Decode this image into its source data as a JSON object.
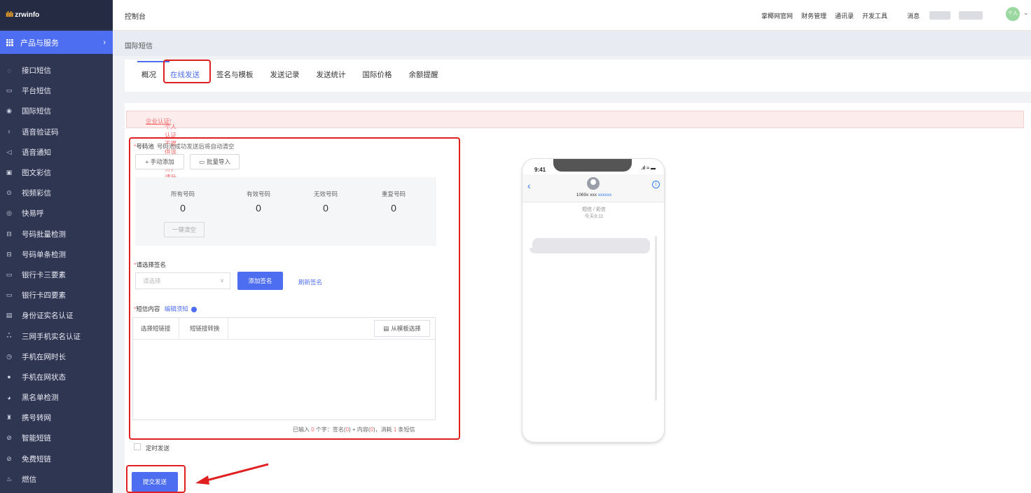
{
  "app": {
    "logo_mark": "ılılı",
    "logo_text": "zrwinfo",
    "section_title": "控制台"
  },
  "sidebar": {
    "product_label": "产品与服务",
    "items": [
      {
        "label": "接口短信",
        "icon": "chat-bubble-icon"
      },
      {
        "label": "平台短信",
        "icon": "message-icon"
      },
      {
        "label": "国际短信",
        "icon": "globe-icon"
      },
      {
        "label": "语音验证码",
        "icon": "microphone-icon"
      },
      {
        "label": "语音通知",
        "icon": "speaker-icon"
      },
      {
        "label": "图文彩信",
        "icon": "image-icon"
      },
      {
        "label": "视频彩信",
        "icon": "play-icon"
      },
      {
        "label": "快易呼",
        "icon": "phone-call-icon"
      },
      {
        "label": "号码批量检测",
        "icon": "scan-icon"
      },
      {
        "label": "号码单条检测",
        "icon": "scan-single-icon"
      },
      {
        "label": "银行卡三要素",
        "icon": "card-icon"
      },
      {
        "label": "银行卡四要素",
        "icon": "card-four-icon"
      },
      {
        "label": "身份证实名认证",
        "icon": "id-card-icon"
      },
      {
        "label": "三网手机实名认证",
        "icon": "users-icon"
      },
      {
        "label": "手机在网时长",
        "icon": "clock-icon"
      },
      {
        "label": "手机在网状态",
        "icon": "status-icon"
      },
      {
        "label": "黑名单检测",
        "icon": "blacklist-icon"
      },
      {
        "label": "携号转网",
        "icon": "transfer-icon"
      },
      {
        "label": "智能短链",
        "icon": "link-icon"
      },
      {
        "label": "免费短链",
        "icon": "free-link-icon"
      },
      {
        "label": "燃信",
        "icon": "flame-icon"
      }
    ]
  },
  "topnav": {
    "items": [
      "掌椰网官网",
      "财务管理",
      "通讯录",
      "开发工具"
    ],
    "messages": "消息",
    "avatar_text": "个人"
  },
  "breadcrumb": "国际短信",
  "tabs": [
    "概况",
    "在线发送",
    "签名与模板",
    "发送记录",
    "发送统计",
    "国际价格",
    "余额提醒"
  ],
  "active_tab": "在线发送",
  "alert": {
    "text": "个人认证不提供该服务，请升级为",
    "link": "企业认证!"
  },
  "form": {
    "pool_label": "号码池",
    "pool_hint": "号码池成功发送后将自动清空",
    "manual_add": "+ 手动添加",
    "batch_import": "批量导入",
    "stats": [
      {
        "label": "所有号码",
        "value": "0"
      },
      {
        "label": "有效号码",
        "value": "0"
      },
      {
        "label": "无效号码",
        "value": "0"
      },
      {
        "label": "重复号码",
        "value": "0"
      }
    ],
    "clear_all": "一键清空",
    "sign_label": "请选择签名",
    "sign_placeholder": "请选择",
    "add_sign": "添加签名",
    "refresh_sign": "刷新签名",
    "content_label": "短信内容",
    "edit_notice": "编辑须知",
    "tb_short_link": "选择短链接",
    "tb_convert": "短链接转换",
    "from_template": "从模板选择",
    "counter_prefix": "已输入",
    "counter_chars": "0",
    "counter_mid": "个字：签名(",
    "counter_sign": "0",
    "counter_mid2": ") + 内容(",
    "counter_content": "0",
    "counter_mid3": ")，消耗",
    "counter_cost": "1",
    "counter_suffix": "条短信",
    "scheduled": "定时发送",
    "submit": "提交发送"
  },
  "phone": {
    "time": "9:41",
    "number_prefix": "1069x xxx ",
    "number_mask": "xxxxxx",
    "kind": "短信 / 彩信",
    "when": "今天9:11"
  }
}
